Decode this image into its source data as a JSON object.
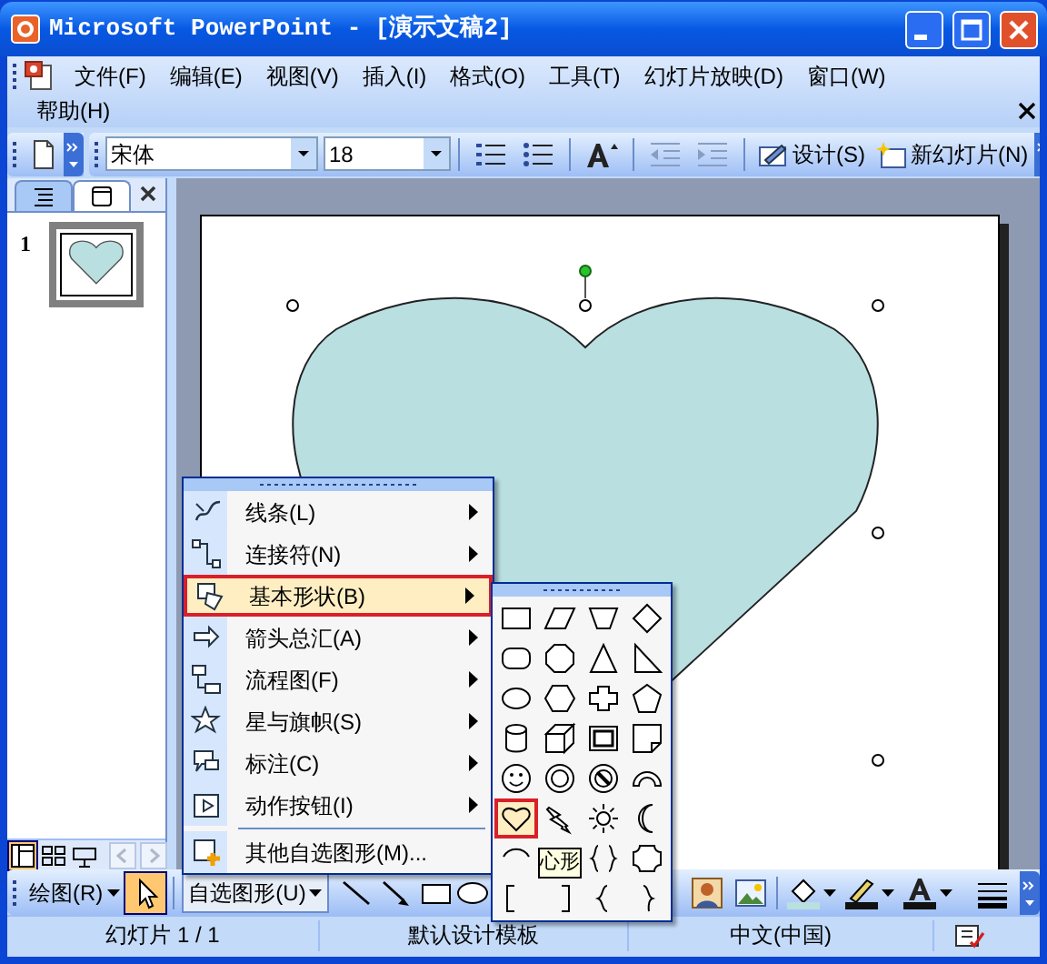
{
  "window": {
    "title": "Microsoft PowerPoint - [演示文稿2]"
  },
  "menu_bar": {
    "items": [
      {
        "label": "文件(F)"
      },
      {
        "label": "编辑(E)"
      },
      {
        "label": "视图(V)"
      },
      {
        "label": "插入(I)"
      },
      {
        "label": "格式(O)"
      },
      {
        "label": "工具(T)"
      },
      {
        "label": "幻灯片放映(D)"
      },
      {
        "label": "窗口(W)"
      },
      {
        "label": "帮助(H)"
      }
    ]
  },
  "formatting_toolbar": {
    "font": "宋体",
    "size": "18",
    "buttons": [
      {
        "kind": "design",
        "label": "设计(S)"
      },
      {
        "kind": "new_slide",
        "label": "新幻灯片(N)"
      }
    ]
  },
  "pane_tabs": [
    {
      "kind": "outline",
      "selected": false
    },
    {
      "kind": "slides",
      "selected": true
    }
  ],
  "slide_thumbnails": [
    {
      "number": "1",
      "selected": true
    }
  ],
  "view_buttons": [
    {
      "kind": "normal",
      "selected": true
    },
    {
      "kind": "sorter",
      "selected": false
    },
    {
      "kind": "show",
      "selected": false
    }
  ],
  "autoshapes_menu": {
    "items": [
      {
        "kind": "lines",
        "label": "线条(L)",
        "submenu": true,
        "selected": false
      },
      {
        "kind": "connectors",
        "label": "连接符(N)",
        "submenu": true,
        "selected": false
      },
      {
        "kind": "basic",
        "label": "基本形状(B)",
        "submenu": true,
        "selected": true
      },
      {
        "kind": "arrows",
        "label": "箭头总汇(A)",
        "submenu": true,
        "selected": false
      },
      {
        "kind": "flowchart",
        "label": "流程图(F)",
        "submenu": true,
        "selected": false
      },
      {
        "kind": "stars",
        "label": "星与旗帜(S)",
        "submenu": true,
        "selected": false
      },
      {
        "kind": "callouts",
        "label": "标注(C)",
        "submenu": true,
        "selected": false
      },
      {
        "kind": "action",
        "label": "动作按钮(I)",
        "submenu": true,
        "selected": false
      },
      {
        "kind": "more",
        "label": "其他自选图形(M)...",
        "submenu": false,
        "selected": false
      }
    ]
  },
  "basic_shapes": {
    "tooltip": "心形",
    "shapes": [
      {
        "kind": "rectangle",
        "selected": false
      },
      {
        "kind": "parallelogram",
        "selected": false
      },
      {
        "kind": "trapezoid",
        "selected": false
      },
      {
        "kind": "diamond",
        "selected": false
      },
      {
        "kind": "rounded_rectangle",
        "selected": false
      },
      {
        "kind": "octagon",
        "selected": false
      },
      {
        "kind": "triangle",
        "selected": false
      },
      {
        "kind": "right_triangle",
        "selected": false
      },
      {
        "kind": "oval",
        "selected": false
      },
      {
        "kind": "hexagon",
        "selected": false
      },
      {
        "kind": "cross",
        "selected": false
      },
      {
        "kind": "pentagon",
        "selected": false
      },
      {
        "kind": "can",
        "selected": false
      },
      {
        "kind": "cube",
        "selected": false
      },
      {
        "kind": "bevel",
        "selected": false
      },
      {
        "kind": "folded_corner",
        "selected": false
      },
      {
        "kind": "smiley",
        "selected": false
      },
      {
        "kind": "donut",
        "selected": false
      },
      {
        "kind": "no_symbol",
        "selected": false
      },
      {
        "kind": "block_arc",
        "selected": false
      },
      {
        "kind": "heart",
        "selected": true
      },
      {
        "kind": "lightning",
        "selected": false
      },
      {
        "kind": "sun",
        "selected": false
      },
      {
        "kind": "moon",
        "selected": false
      },
      {
        "kind": "arc",
        "selected": false
      },
      {
        "kind": "brace_pair",
        "selected": false
      },
      {
        "kind": "plaque",
        "selected": false
      },
      {
        "kind": "left_bracket",
        "selected": false
      },
      {
        "kind": "right_bracket",
        "selected": false
      },
      {
        "kind": "left_brace",
        "selected": false
      },
      {
        "kind": "right_brace",
        "selected": false
      }
    ]
  },
  "drawing_toolbar": {
    "draw_menu": "绘图(R)",
    "pointer_selected": true,
    "autoshapes_label": "自选图形(U)",
    "autoshapes_open": true
  },
  "status_bar": {
    "slide": "幻灯片 1 / 1",
    "design": "默认设计模板",
    "language": "中文(中国)"
  }
}
